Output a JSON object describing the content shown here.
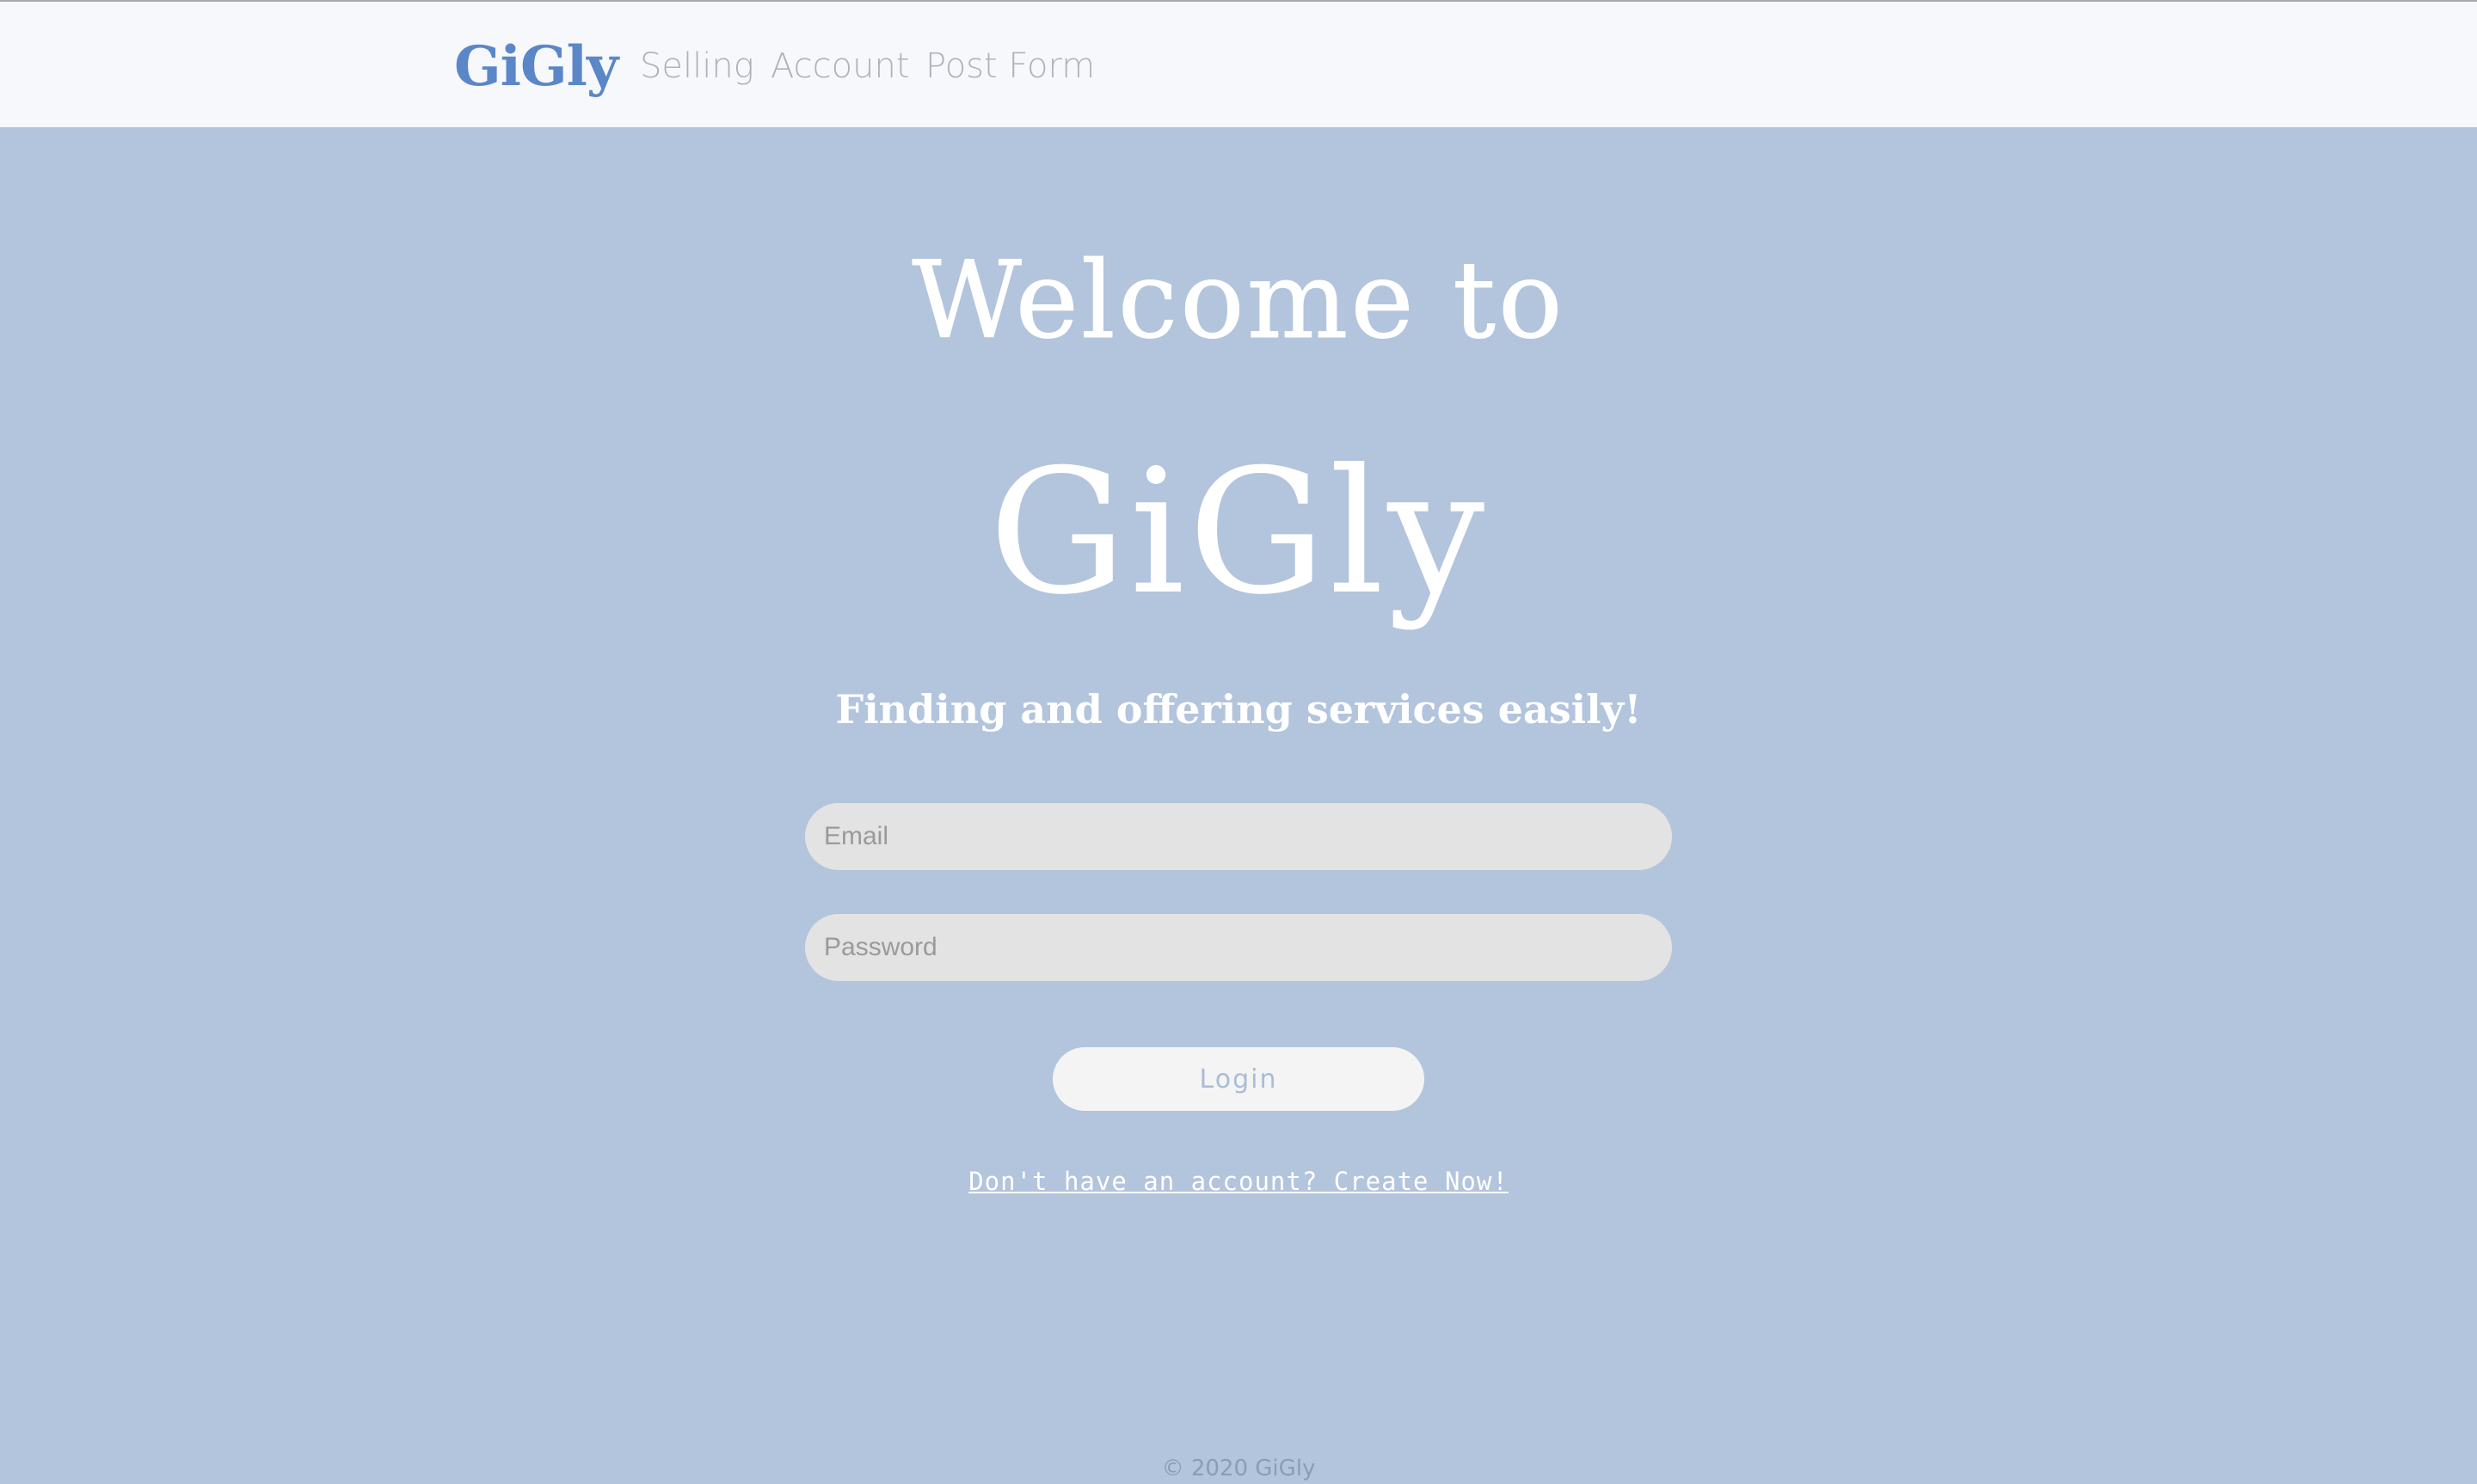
{
  "navbar": {
    "brand": "GiGly",
    "links": [
      "Selling",
      "Account",
      "Post Form"
    ]
  },
  "hero": {
    "welcome": "Welcome to",
    "title": "GiGly",
    "tagline": "Finding and offering services easily!"
  },
  "login_form": {
    "email_placeholder": "Email",
    "password_placeholder": "Password",
    "login_label": "Login",
    "signup_text": "Don't have an account? Create Now!"
  },
  "footer": {
    "copyright": "© 2020 GiGly"
  },
  "colors": {
    "background": "#b3c4dd",
    "navbar": "#f7f8fb",
    "brand": "#5b87c9",
    "nav_link": "#aeb2bb",
    "input_bg": "#e3e3e3",
    "button_bg": "#f4f4f4",
    "button_text": "#aabcd6"
  }
}
